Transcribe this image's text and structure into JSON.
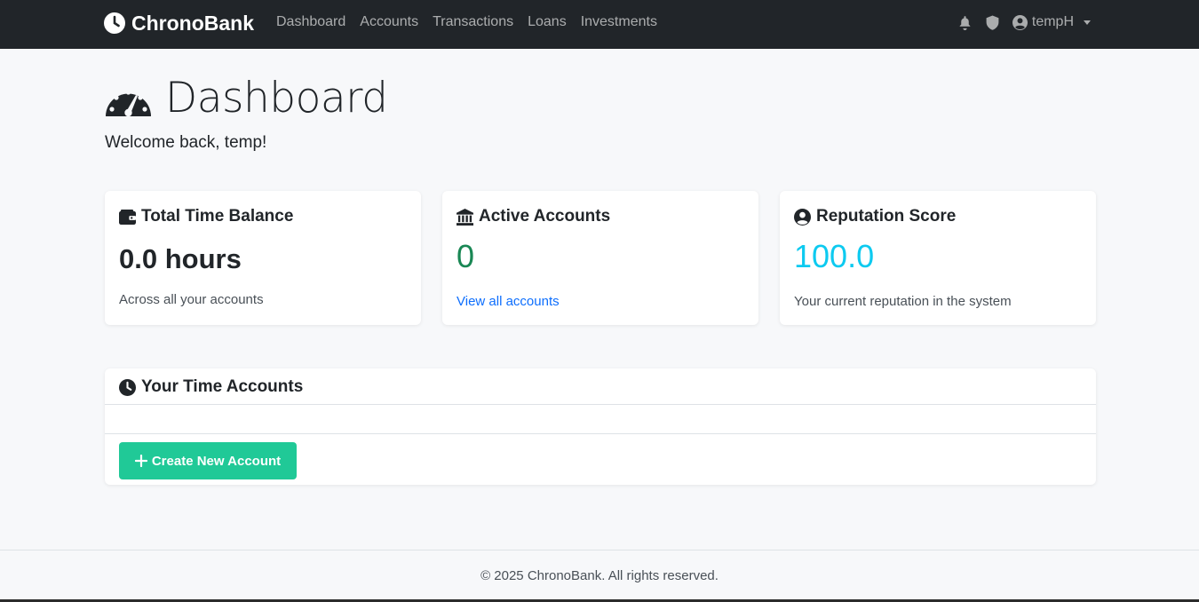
{
  "navbar": {
    "brand": "ChronoBank",
    "links": [
      "Dashboard",
      "Accounts",
      "Transactions",
      "Loans",
      "Investments"
    ],
    "user": "tempH"
  },
  "header": {
    "title": "Dashboard",
    "welcome": "Welcome back, temp!"
  },
  "cards": {
    "balance": {
      "title": "Total Time Balance",
      "value": "0.0 hours",
      "caption": "Across all your accounts"
    },
    "accounts": {
      "title": "Active Accounts",
      "value": "0",
      "link": "View all accounts"
    },
    "reputation": {
      "title": "Reputation Score",
      "value": "100.0",
      "caption": "Your current reputation in the system"
    }
  },
  "time_accounts": {
    "title": "Your Time Accounts",
    "create_button": "Create New Account"
  },
  "footer": {
    "text": "© 2025 ChronoBank. All rights reserved."
  },
  "colors": {
    "navbar_bg": "#212529",
    "accent_green": "#198754",
    "accent_cyan": "#0dcaf0",
    "button_teal": "#20c997",
    "link_blue": "#0d6efd"
  }
}
